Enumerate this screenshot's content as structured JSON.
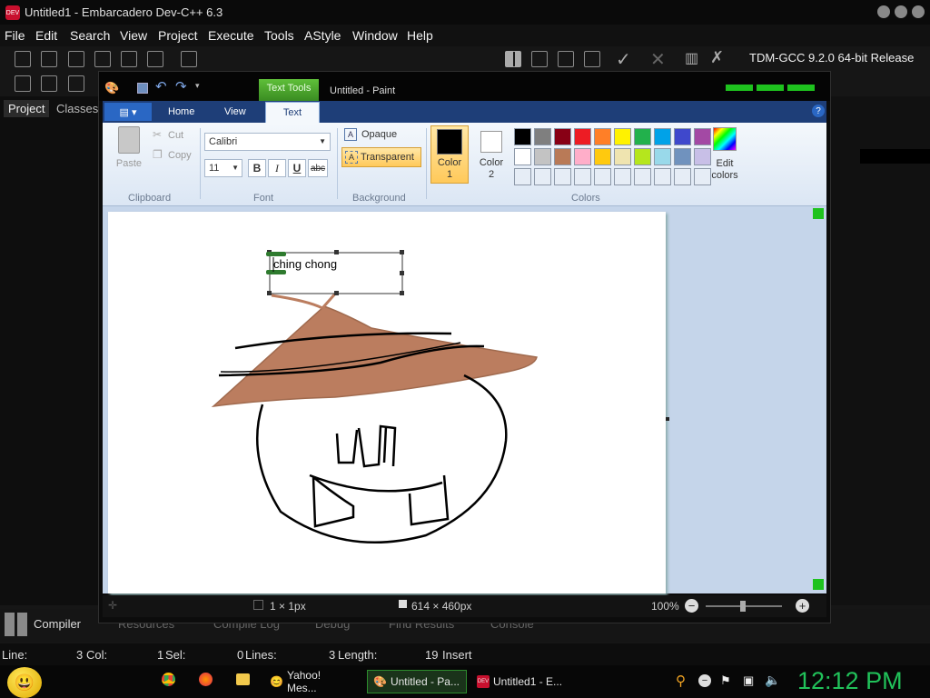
{
  "devcpp": {
    "title": "Untitled1 - Embarcadero Dev-C++ 6.3",
    "menu": [
      "File",
      "Edit",
      "Search",
      "View",
      "Project",
      "Execute",
      "Tools",
      "AStyle",
      "Window",
      "Help"
    ],
    "compiler": "TDM-GCC 9.2.0 64-bit Release",
    "left_tabs": [
      "Project",
      "Classes"
    ],
    "bottom_tabs": [
      "Compiler",
      "Resources",
      "Compile Log",
      "Debug",
      "Find Results",
      "Console"
    ],
    "status": {
      "line_label": "Line:",
      "line_value": "3",
      "col_label": "Col:",
      "col_value": "1",
      "sel_label": "Sel:",
      "sel_value": "0",
      "lines_label": "Lines:",
      "lines_value": "3",
      "length_label": "Length:",
      "length_value": "19",
      "mode": "Insert"
    }
  },
  "paint": {
    "title": "Untitled - Paint",
    "context_tab": "Text Tools",
    "tabs": [
      "Home",
      "View",
      "Text"
    ],
    "active_tab": "Text",
    "clipboard": {
      "paste": "Paste",
      "cut": "Cut",
      "copy": "Copy",
      "group": "Clipboard"
    },
    "font": {
      "family": "Calibri",
      "size": "11",
      "bold": "B",
      "italic": "I",
      "underline": "U",
      "strike": "abc",
      "group": "Font"
    },
    "background": {
      "opaque": "Opaque",
      "transparent": "Transparent",
      "group": "Background"
    },
    "colors": {
      "color1_label": "Color\n1",
      "color1_a": "Color",
      "color1_b": "1",
      "color2_a": "Color",
      "color2_b": "2",
      "edit_a": "Edit",
      "edit_b": "colors",
      "group": "Colors",
      "color1_value": "#000000",
      "color2_value": "#ffffff",
      "row1": [
        "#000000",
        "#7f7f7f",
        "#880015",
        "#ed1c24",
        "#ff7f27",
        "#fff200",
        "#22b14c",
        "#00a2e8",
        "#3f48cc",
        "#a349a4"
      ],
      "row2": [
        "#ffffff",
        "#c3c3c3",
        "#b97a57",
        "#ffaec9",
        "#ffc90e",
        "#efe4b0",
        "#b5e61d",
        "#99d9ea",
        "#7092be",
        "#c8bfe7"
      ]
    },
    "canvas_text": "ching chong",
    "status": {
      "cursor": "1 × 1px",
      "size": "614 × 460px",
      "zoom": "100%"
    }
  },
  "taskbar": {
    "items": [
      "Yahoo! Mes...",
      "Untitled - Pa...",
      "Untitled1 - E..."
    ],
    "clock": "12:12 PM"
  }
}
